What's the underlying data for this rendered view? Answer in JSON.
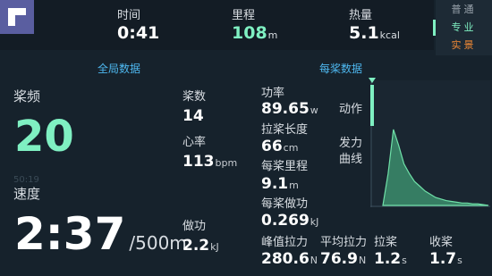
{
  "header": {
    "stats": [
      {
        "label": "时间",
        "value": "0:41",
        "unit": ""
      },
      {
        "label": "里程",
        "value": "108",
        "unit": "m"
      },
      {
        "label": "热量",
        "value": "5.1",
        "unit": "kcal"
      }
    ],
    "modes": [
      {
        "label": "普通"
      },
      {
        "label": "专业"
      },
      {
        "label": "实景"
      }
    ]
  },
  "global": {
    "title": "全局数据",
    "stroke_rate_label": "桨频",
    "stroke_rate_value": "20",
    "ghost_text": "50:19",
    "speed_label": "速度",
    "speed_value": "2:37",
    "speed_unit": "/500m",
    "stroke_count_label": "桨数",
    "stroke_count_value": "14",
    "heart_label": "心率",
    "heart_value": "113",
    "heart_unit": "bpm",
    "work_label": "做功",
    "work_value": "2.2",
    "work_unit": "kJ"
  },
  "per_stroke": {
    "title": "每桨数据",
    "power_label": "功率",
    "power_value": "89.65",
    "power_unit": "w",
    "length_label": "拉桨长度",
    "length_value": "66",
    "length_unit": "cm",
    "distance_label": "每桨里程",
    "distance_value": "9.1",
    "distance_unit": "m",
    "work_label": "每桨做功",
    "work_value": "0.269",
    "work_unit": "kJ",
    "peak_label": "峰值拉力",
    "peak_value": "280.6",
    "peak_unit": "N",
    "avg_label": "平均拉力",
    "avg_value": "76.9",
    "avg_unit": "N",
    "pull_label": "拉桨",
    "pull_value": "1.2",
    "pull_unit": "s",
    "recovery_label": "收桨",
    "recovery_value": "1.7",
    "recovery_unit": "s",
    "motion_label": "动作",
    "force_curve_label": "发力曲线",
    "force_curve_line1": "发力",
    "force_curve_line2": "曲线"
  },
  "colors": {
    "accent_green": "#7ff0c2",
    "accent_blue": "#4eb8f0",
    "accent_orange": "#f28a35",
    "bg": "#16222c"
  },
  "chart_data": {
    "type": "area",
    "x": [
      0,
      1,
      2,
      3,
      4,
      5,
      6,
      7,
      8,
      9,
      10,
      11,
      12,
      13,
      14,
      15,
      16,
      17,
      18,
      19,
      20
    ],
    "values": [
      0,
      40,
      95,
      75,
      52,
      40,
      30,
      24,
      18,
      14,
      10,
      8,
      6,
      5,
      4,
      3,
      3,
      2,
      2,
      1,
      0
    ]
  }
}
